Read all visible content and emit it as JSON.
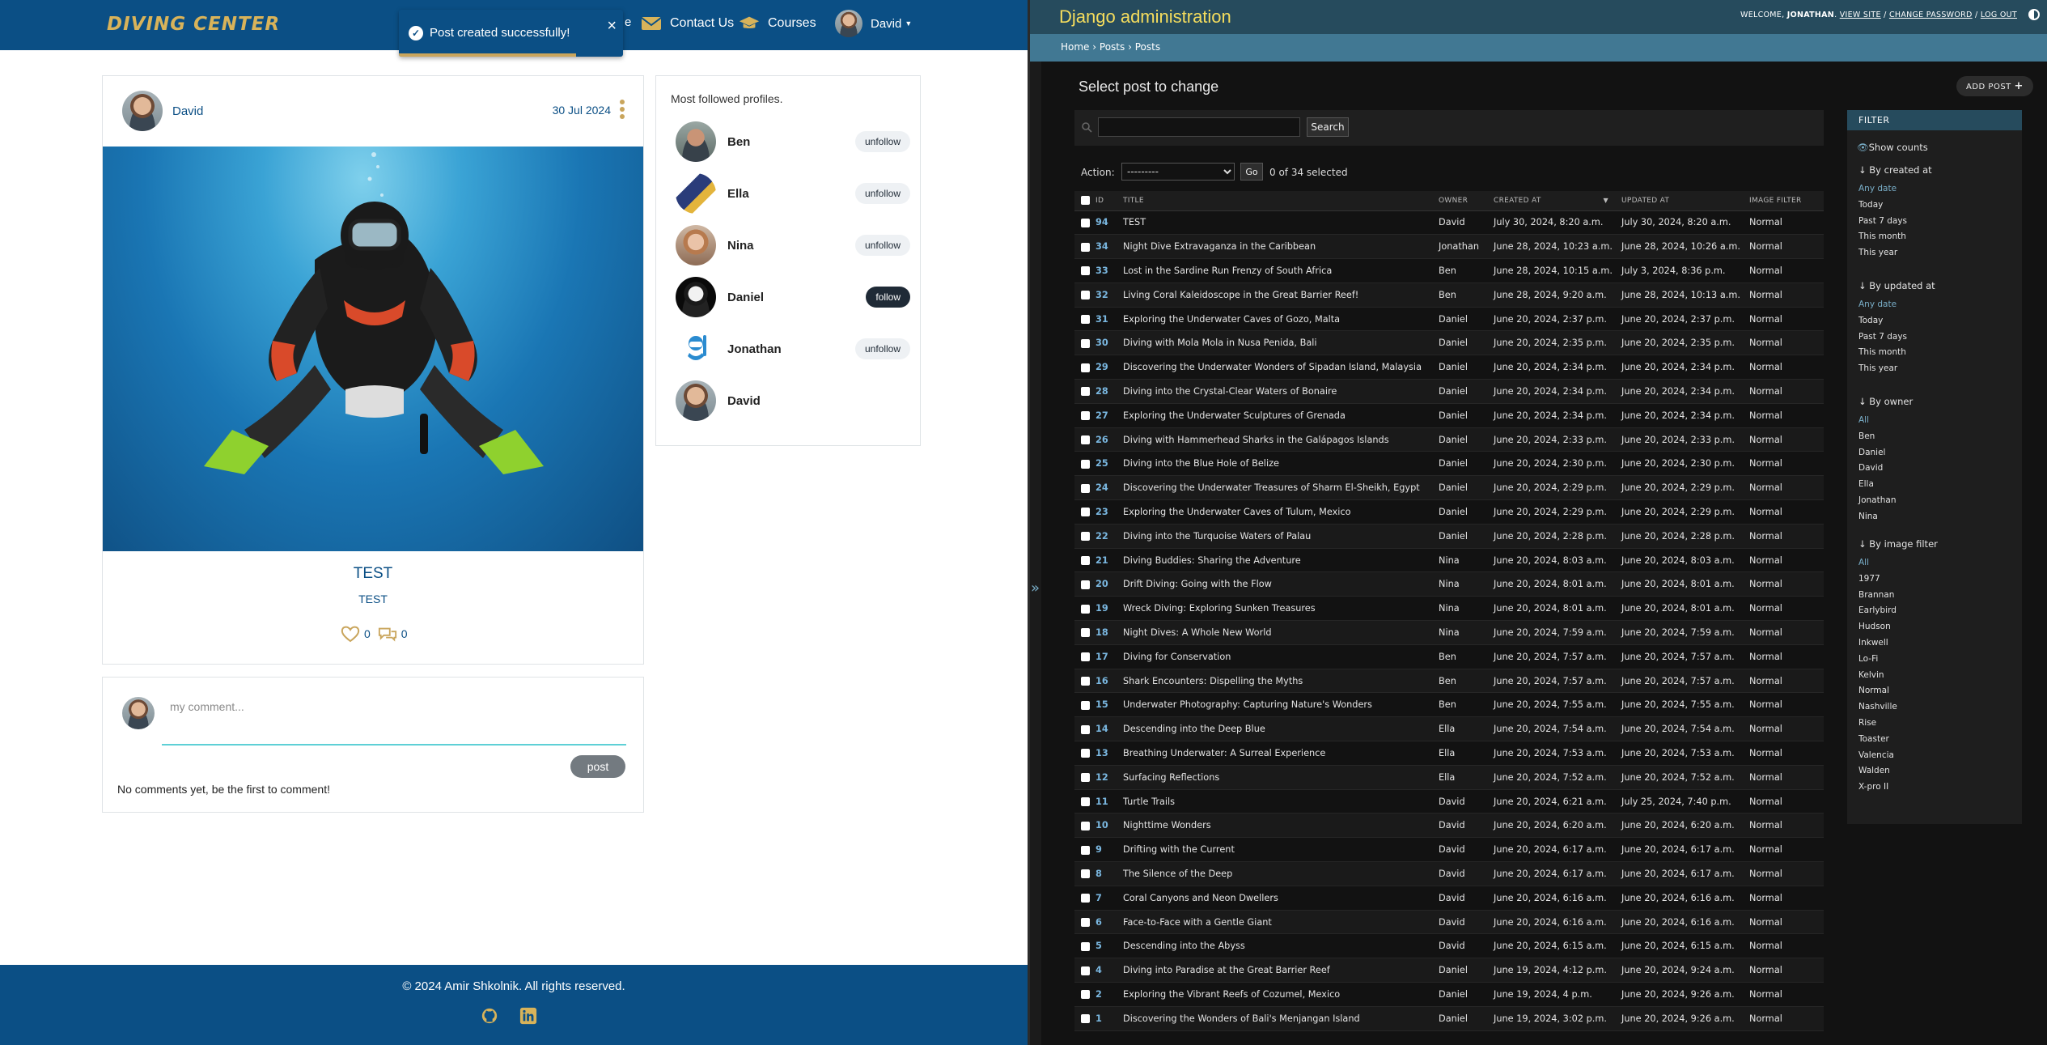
{
  "left_app": {
    "nav": {
      "logo_text": "DIVING CENTER",
      "partial_link": "e",
      "contact_label": "Contact Us",
      "courses_label": "Courses",
      "user_label": "David"
    },
    "toast": {
      "message": "Post created successfully!",
      "close": "×",
      "progress": 0.79
    },
    "post": {
      "author": "David",
      "date": "30 Jul 2024",
      "title": "TEST",
      "content": "TEST",
      "likes": "0",
      "comments": "0"
    },
    "comment_form": {
      "placeholder": "my comment...",
      "post_label": "post",
      "empty_message": "No comments yet, be the first to comment!"
    },
    "profiles": {
      "title": "Most followed profiles.",
      "items": [
        {
          "name": "Ben",
          "button": "unfollow",
          "style": "unfollow"
        },
        {
          "name": "Ella",
          "button": "unfollow",
          "style": "unfollow"
        },
        {
          "name": "Nina",
          "button": "unfollow",
          "style": "unfollow"
        },
        {
          "name": "Daniel",
          "button": "follow",
          "style": "follow"
        },
        {
          "name": "Jonathan",
          "button": "unfollow",
          "style": "unfollow"
        },
        {
          "name": "David",
          "button": "",
          "style": "none"
        }
      ]
    },
    "footer": {
      "text": "© 2024 Amir Shkolnik. All rights reserved.",
      "icons": [
        "github-icon",
        "linkedin-icon"
      ]
    },
    "colors": {
      "brand": "#0b4f85",
      "accent": "#c9a55c"
    }
  },
  "admin": {
    "brand": "Django administration",
    "usertools": {
      "welcome": "WELCOME,",
      "user": "JONATHAN",
      "view_site": "VIEW SITE",
      "change_password": "CHANGE PASSWORD",
      "logout": "LOG OUT",
      "sep": "/"
    },
    "breadcrumbs": {
      "home": "Home",
      "app": "Posts",
      "model": "Posts",
      "sep": "›"
    },
    "collapse_label": "»",
    "heading": "Select post to change",
    "add_button": "ADD POST",
    "search_button": "Search",
    "search_value": "",
    "action_label": "Action:",
    "action_selected": "---------",
    "go_label": "Go",
    "selected_count": "0 of 34 selected",
    "columns": [
      "ID",
      "TITLE",
      "OWNER",
      "CREATED AT",
      "UPDATED AT",
      "IMAGE FILTER"
    ],
    "rows": [
      [
        "94",
        "TEST",
        "David",
        "July 30, 2024, 8:20 a.m.",
        "July 30, 2024, 8:20 a.m.",
        "Normal"
      ],
      [
        "34",
        "Night Dive Extravaganza in the Caribbean",
        "Jonathan",
        "June 28, 2024, 10:23 a.m.",
        "June 28, 2024, 10:26 a.m.",
        "Normal"
      ],
      [
        "33",
        "Lost in the Sardine Run Frenzy of South Africa",
        "Ben",
        "June 28, 2024, 10:15 a.m.",
        "July 3, 2024, 8:36 p.m.",
        "Normal"
      ],
      [
        "32",
        "Living Coral Kaleidoscope in the Great Barrier Reef!",
        "Ben",
        "June 28, 2024, 9:20 a.m.",
        "June 28, 2024, 10:13 a.m.",
        "Normal"
      ],
      [
        "31",
        "Exploring the Underwater Caves of Gozo, Malta",
        "Daniel",
        "June 20, 2024, 2:37 p.m.",
        "June 20, 2024, 2:37 p.m.",
        "Normal"
      ],
      [
        "30",
        "Diving with Mola Mola in Nusa Penida, Bali",
        "Daniel",
        "June 20, 2024, 2:35 p.m.",
        "June 20, 2024, 2:35 p.m.",
        "Normal"
      ],
      [
        "29",
        "Discovering the Underwater Wonders of Sipadan Island, Malaysia",
        "Daniel",
        "June 20, 2024, 2:34 p.m.",
        "June 20, 2024, 2:34 p.m.",
        "Normal"
      ],
      [
        "28",
        "Diving into the Crystal-Clear Waters of Bonaire",
        "Daniel",
        "June 20, 2024, 2:34 p.m.",
        "June 20, 2024, 2:34 p.m.",
        "Normal"
      ],
      [
        "27",
        "Exploring the Underwater Sculptures of Grenada",
        "Daniel",
        "June 20, 2024, 2:34 p.m.",
        "June 20, 2024, 2:34 p.m.",
        "Normal"
      ],
      [
        "26",
        "Diving with Hammerhead Sharks in the Galápagos Islands",
        "Daniel",
        "June 20, 2024, 2:33 p.m.",
        "June 20, 2024, 2:33 p.m.",
        "Normal"
      ],
      [
        "25",
        "Diving into the Blue Hole of Belize",
        "Daniel",
        "June 20, 2024, 2:30 p.m.",
        "June 20, 2024, 2:30 p.m.",
        "Normal"
      ],
      [
        "24",
        "Discovering the Underwater Treasures of Sharm El-Sheikh, Egypt",
        "Daniel",
        "June 20, 2024, 2:29 p.m.",
        "June 20, 2024, 2:29 p.m.",
        "Normal"
      ],
      [
        "23",
        "Exploring the Underwater Caves of Tulum, Mexico",
        "Daniel",
        "June 20, 2024, 2:29 p.m.",
        "June 20, 2024, 2:29 p.m.",
        "Normal"
      ],
      [
        "22",
        "Diving into the Turquoise Waters of Palau",
        "Daniel",
        "June 20, 2024, 2:28 p.m.",
        "June 20, 2024, 2:28 p.m.",
        "Normal"
      ],
      [
        "21",
        "Diving Buddies: Sharing the Adventure",
        "Nina",
        "June 20, 2024, 8:03 a.m.",
        "June 20, 2024, 8:03 a.m.",
        "Normal"
      ],
      [
        "20",
        "Drift Diving: Going with the Flow",
        "Nina",
        "June 20, 2024, 8:01 a.m.",
        "June 20, 2024, 8:01 a.m.",
        "Normal"
      ],
      [
        "19",
        "Wreck Diving: Exploring Sunken Treasures",
        "Nina",
        "June 20, 2024, 8:01 a.m.",
        "June 20, 2024, 8:01 a.m.",
        "Normal"
      ],
      [
        "18",
        "Night Dives: A Whole New World",
        "Nina",
        "June 20, 2024, 7:59 a.m.",
        "June 20, 2024, 7:59 a.m.",
        "Normal"
      ],
      [
        "17",
        "Diving for Conservation",
        "Ben",
        "June 20, 2024, 7:57 a.m.",
        "June 20, 2024, 7:57 a.m.",
        "Normal"
      ],
      [
        "16",
        "Shark Encounters: Dispelling the Myths",
        "Ben",
        "June 20, 2024, 7:57 a.m.",
        "June 20, 2024, 7:57 a.m.",
        "Normal"
      ],
      [
        "15",
        "Underwater Photography: Capturing Nature's Wonders",
        "Ben",
        "June 20, 2024, 7:55 a.m.",
        "June 20, 2024, 7:55 a.m.",
        "Normal"
      ],
      [
        "14",
        "Descending into the Deep Blue",
        "Ella",
        "June 20, 2024, 7:54 a.m.",
        "June 20, 2024, 7:54 a.m.",
        "Normal"
      ],
      [
        "13",
        "Breathing Underwater: A Surreal Experience",
        "Ella",
        "June 20, 2024, 7:53 a.m.",
        "June 20, 2024, 7:53 a.m.",
        "Normal"
      ],
      [
        "12",
        "Surfacing Reflections",
        "Ella",
        "June 20, 2024, 7:52 a.m.",
        "June 20, 2024, 7:52 a.m.",
        "Normal"
      ],
      [
        "11",
        "Turtle Trails",
        "David",
        "June 20, 2024, 6:21 a.m.",
        "July 25, 2024, 7:40 p.m.",
        "Normal"
      ],
      [
        "10",
        "Nighttime Wonders",
        "David",
        "June 20, 2024, 6:20 a.m.",
        "June 20, 2024, 6:20 a.m.",
        "Normal"
      ],
      [
        "9",
        "Drifting with the Current",
        "David",
        "June 20, 2024, 6:17 a.m.",
        "June 20, 2024, 6:17 a.m.",
        "Normal"
      ],
      [
        "8",
        "The Silence of the Deep",
        "David",
        "June 20, 2024, 6:17 a.m.",
        "June 20, 2024, 6:17 a.m.",
        "Normal"
      ],
      [
        "7",
        "Coral Canyons and Neon Dwellers",
        "David",
        "June 20, 2024, 6:16 a.m.",
        "June 20, 2024, 6:16 a.m.",
        "Normal"
      ],
      [
        "6",
        "Face-to-Face with a Gentle Giant",
        "David",
        "June 20, 2024, 6:16 a.m.",
        "June 20, 2024, 6:16 a.m.",
        "Normal"
      ],
      [
        "5",
        "Descending into the Abyss",
        "David",
        "June 20, 2024, 6:15 a.m.",
        "June 20, 2024, 6:15 a.m.",
        "Normal"
      ],
      [
        "4",
        "Diving into Paradise at the Great Barrier Reef",
        "Daniel",
        "June 19, 2024, 4:12 p.m.",
        "June 20, 2024, 9:24 a.m.",
        "Normal"
      ],
      [
        "2",
        "Exploring the Vibrant Reefs of Cozumel, Mexico",
        "Daniel",
        "June 19, 2024, 4 p.m.",
        "June 20, 2024, 9:26 a.m.",
        "Normal"
      ],
      [
        "1",
        "Discovering the Wonders of Bali's Menjangan Island",
        "Daniel",
        "June 19, 2024, 3:02 p.m.",
        "June 20, 2024, 9:26 a.m.",
        "Normal"
      ]
    ],
    "filter": {
      "title": "FILTER",
      "show_counts": "Show counts",
      "groups": [
        {
          "title": "↓ By created at",
          "options": [
            "Any date",
            "Today",
            "Past 7 days",
            "This month",
            "This year"
          ]
        },
        {
          "title": "↓ By updated at",
          "options": [
            "Any date",
            "Today",
            "Past 7 days",
            "This month",
            "This year"
          ]
        },
        {
          "title": "↓ By owner",
          "options": [
            "All",
            "Ben",
            "Daniel",
            "David",
            "Ella",
            "Jonathan",
            "Nina"
          ]
        },
        {
          "title": "↓ By image filter",
          "options": [
            "All",
            "1977",
            "Brannan",
            "Earlybird",
            "Hudson",
            "Inkwell",
            "Lo-Fi",
            "Kelvin",
            "Normal",
            "Nashville",
            "Rise",
            "Toaster",
            "Valencia",
            "Walden",
            "X-pro II"
          ]
        }
      ]
    },
    "colors": {
      "header": "#264b5d",
      "breadcrumb": "#417893",
      "brand_text": "#f5dd5d",
      "link": "#79aec8"
    }
  }
}
